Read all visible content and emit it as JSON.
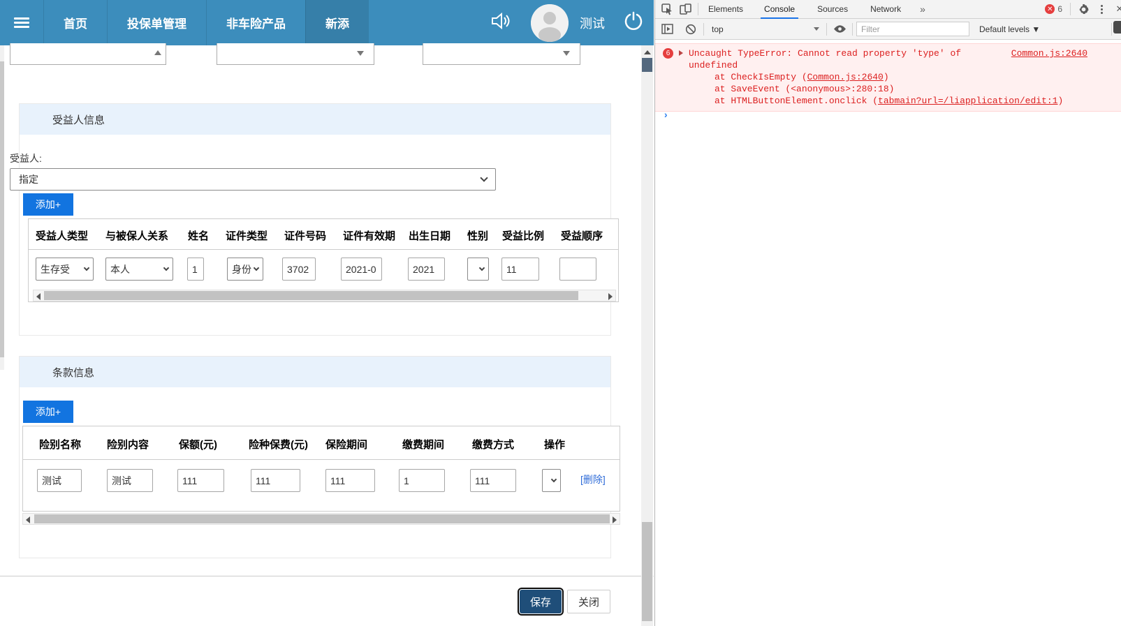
{
  "nav": {
    "items": [
      {
        "label": "首页"
      },
      {
        "label": "投保单管理"
      },
      {
        "label": "非车险产品"
      },
      {
        "label": "新添"
      }
    ],
    "active_index": 3,
    "user": "测试",
    "bar_color": "#3c8dbc",
    "active_color": "#367fa9"
  },
  "beneficiary": {
    "section_title": "受益人信息",
    "field_label": "受益人:",
    "select_value": "指定",
    "add_button": "添加+",
    "headers": [
      "受益人类型",
      "与被保人关系",
      "姓名",
      "证件类型",
      "证件号码",
      "证件有效期",
      "出生日期",
      "性别",
      "受益比例",
      "受益顺序"
    ],
    "row": {
      "type": "生存受",
      "relation": "本人",
      "name": "1",
      "id_type": "身份",
      "id_no": "3702",
      "id_validity": "2021-0",
      "birth": "2021",
      "gender": "",
      "ratio": "11",
      "order": ""
    }
  },
  "terms": {
    "section_title": "条款信息",
    "add_button": "添加+",
    "headers": [
      "险别名称",
      "险别内容",
      "保额(元)",
      "险种保费(元)",
      "保险期间",
      "缴费期间",
      "缴费方式",
      "操作"
    ],
    "row": {
      "name": "测试",
      "content": "测试",
      "amount": "111",
      "premium": "111",
      "period": "111",
      "pay_period": "1",
      "pay_method": "111",
      "pay_select": "",
      "action": "[删除]"
    }
  },
  "footer": {
    "save": "保存",
    "close": "关闭",
    "save_color": "#1f4e79"
  },
  "devtools": {
    "tabs": [
      {
        "label": "Elements"
      },
      {
        "label": "Console"
      },
      {
        "label": "Sources"
      },
      {
        "label": "Network"
      }
    ],
    "active_tab": "Console",
    "more_tabs": "»",
    "error_count": "6",
    "badge_x": "✕",
    "toolbar": {
      "frame_select": "top",
      "filter_placeholder": "Filter",
      "levels_select": "Default levels ▼"
    },
    "console": {
      "dup_count": "6",
      "message": "Uncaught TypeError: Cannot read property 'type' of undefined",
      "source_link": "Common.js:2640",
      "stack": [
        {
          "pre": "at CheckIsEmpty (",
          "link": "Common.js:2640",
          "post": ")"
        },
        {
          "pre": "at SaveEvent (<anonymous>:280:18)",
          "link": "",
          "post": ""
        },
        {
          "pre": "at HTMLButtonElement.onclick (",
          "link": "tabmain?url=/liapplication/edit:1",
          "post": ")"
        }
      ],
      "prompt": "›",
      "error_color": "#dc2020",
      "error_bg": "#fff0f0"
    }
  }
}
